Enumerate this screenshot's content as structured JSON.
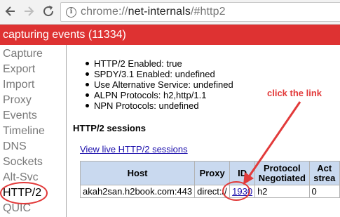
{
  "browser": {
    "back_icon": "back-arrow-icon",
    "forward_icon": "forward-arrow-icon",
    "reload_icon": "reload-icon",
    "url_scheme": "chrome://",
    "url_host": "net-internals",
    "url_path": "/#http2"
  },
  "status_bar": {
    "text": "capturing events (11334)",
    "color": "#de3232"
  },
  "sidebar": {
    "tabs": [
      "Capture",
      "Export",
      "Import",
      "Proxy",
      "Events",
      "Timeline",
      "DNS",
      "Sockets",
      "Alt-Svc",
      "HTTP/2",
      "QUIC"
    ],
    "selected": "HTTP/2"
  },
  "http2_status": [
    "HTTP/2 Enabled: true",
    "SPDY/3.1 Enabled: undefined",
    "Use Alternative Service: undefined",
    "ALPN Protocols: h2,http/1.1",
    "NPN Protocols: undefined"
  ],
  "sessions": {
    "title": "HTTP/2 sessions",
    "live_link": "View live HTTP/2 sessions",
    "headers": {
      "host": "Host",
      "proxy": "Proxy",
      "id": "ID",
      "protocol_line1": "Protocol",
      "protocol_line2": "Negotiated",
      "active_line1": "Act",
      "active_line2": "strea"
    },
    "rows": [
      {
        "host": "akah2san.h2book.com:443",
        "proxy": "direct://",
        "id": "1930",
        "protocol": "h2",
        "active": "0"
      }
    ]
  },
  "annotation": {
    "callout": "click the link",
    "color": "#e23a3a"
  }
}
